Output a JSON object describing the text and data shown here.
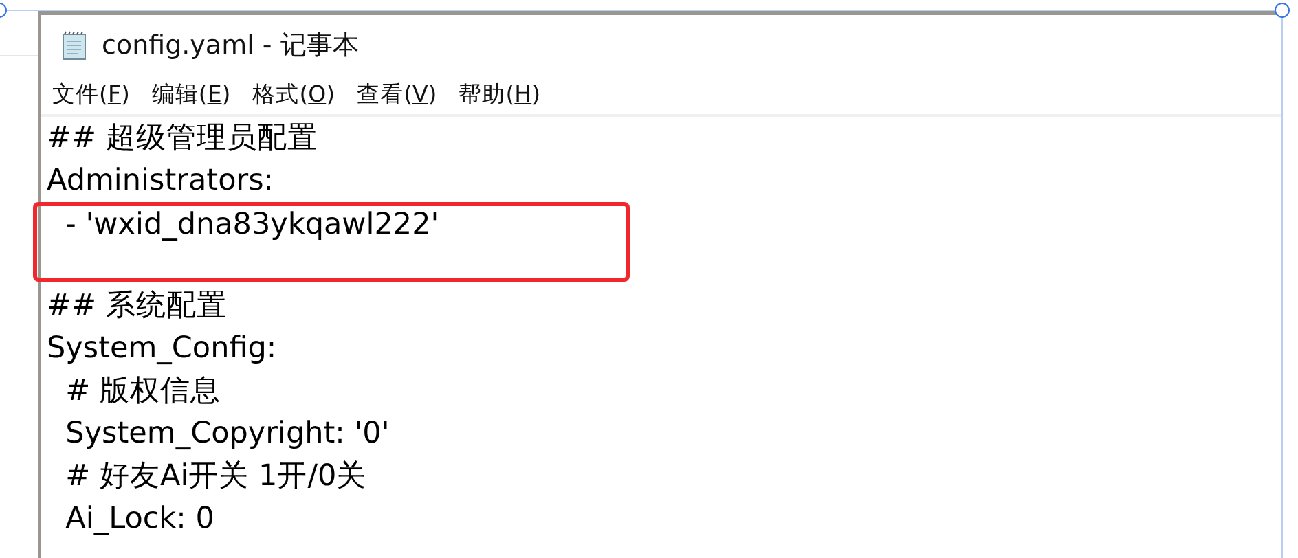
{
  "window": {
    "title": "config.yaml - 记事本"
  },
  "menu": [
    {
      "label": "文件(F)"
    },
    {
      "label": "编辑(E)"
    },
    {
      "label": "格式(O)"
    },
    {
      "label": "查看(V)"
    },
    {
      "label": "帮助(H)"
    }
  ],
  "document": [
    {
      "kind": "line",
      "text": "## 超级管理员配置"
    },
    {
      "kind": "line",
      "text": "Administrators:"
    },
    {
      "kind": "highlight",
      "lines": [
        "  - 'wxid_dna83ykqawl222'"
      ]
    },
    {
      "kind": "line",
      "text": "## 系统配置"
    },
    {
      "kind": "line",
      "text": "System_Config:"
    },
    {
      "kind": "line",
      "text": "  # 版权信息"
    },
    {
      "kind": "line",
      "text": "  System_Copyright: '0'"
    },
    {
      "kind": "line",
      "text": "  # 好友Ai开关 1开/0关"
    },
    {
      "kind": "line",
      "text": "  Ai_Lock: 0"
    }
  ]
}
